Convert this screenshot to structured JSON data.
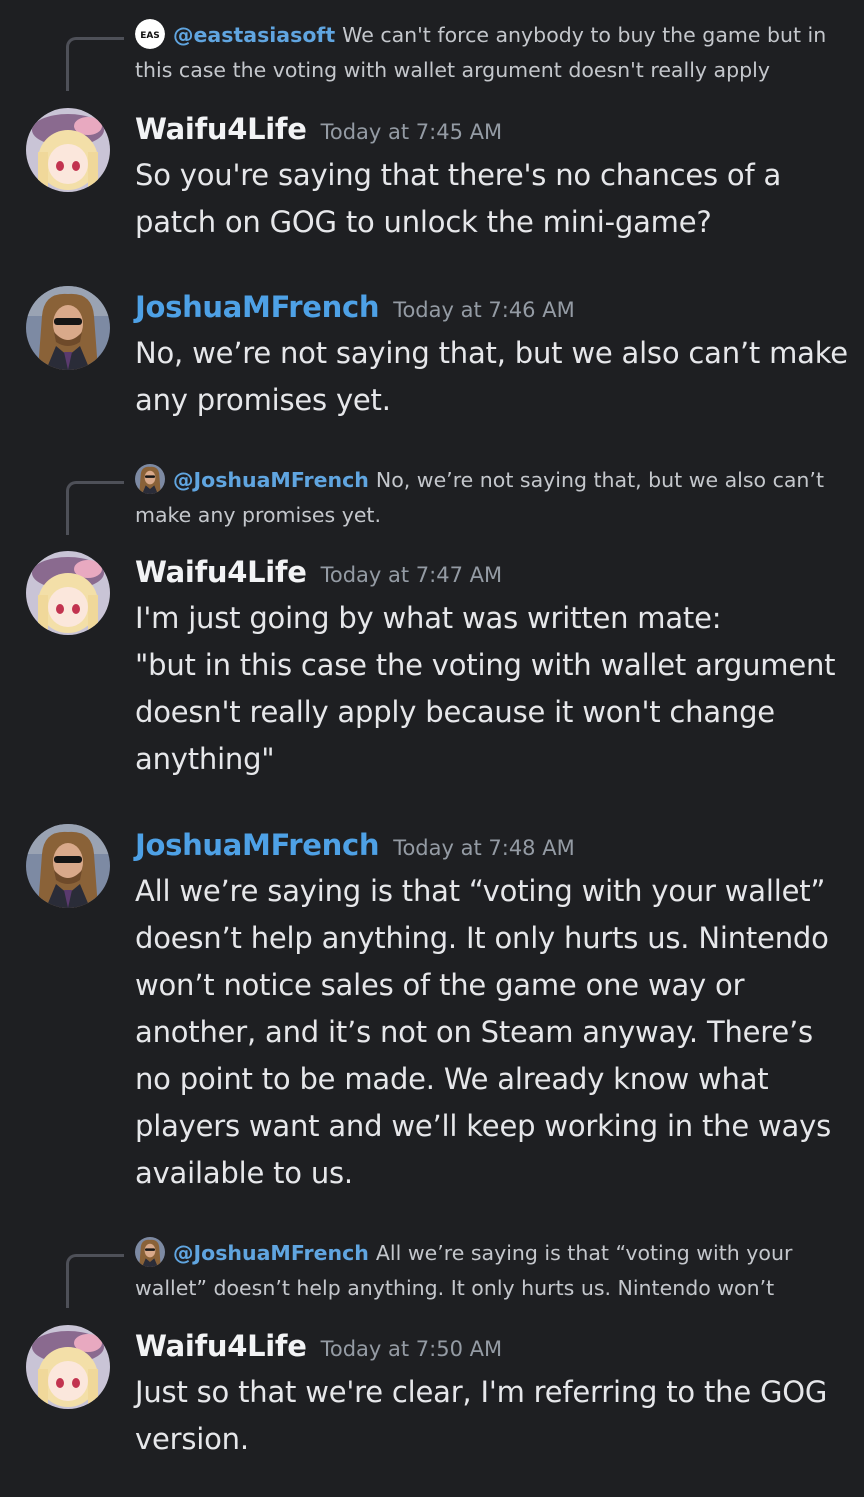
{
  "channel_messages": [
    {
      "reply": {
        "avatar_icon": "eastasiasoft-logo-icon",
        "avatar_text": "EAS",
        "mention": "@eastasiasoft",
        "text": "We can't force anybody to buy the game but in this case the voting with wallet argument doesn't really apply"
      },
      "author": "Waifu4Life",
      "author_color": "#f2f3f5",
      "timestamp": "Today at 7:45 AM",
      "body": "So you're saying that there's no chances of a\npatch on GOG to unlock the mini-game?"
    },
    {
      "author": "JoshuaMFrench",
      "author_color": "#4ea1e6",
      "timestamp": "Today at 7:46 AM",
      "body": "No, we’re not saying that, but we also can’t make\nany promises yet."
    },
    {
      "reply": {
        "avatar_icon": "joshuamfrench-avatar-icon",
        "mention": "@JoshuaMFrench",
        "text": "No, we’re not saying that, but we also can’t make any promises yet."
      },
      "author": "Waifu4Life",
      "author_color": "#f2f3f5",
      "timestamp": "Today at 7:47 AM",
      "body": "I'm just going by what was written mate:\n\"but in this case the voting with wallet argument\ndoesn't really apply because it won't change\nanything\""
    },
    {
      "author": "JoshuaMFrench",
      "author_color": "#4ea1e6",
      "timestamp": "Today at 7:48 AM",
      "body": "All we’re saying is that “voting with your wallet”\ndoesn’t help anything. It only hurts us. Nintendo\nwon’t notice sales of the game one way or\nanother, and it’s not on Steam anyway. There’s\nno point to be made. We already know what\nplayers want and we’ll keep working in the ways\navailable to us."
    },
    {
      "reply": {
        "avatar_icon": "joshuamfrench-avatar-icon",
        "mention": "@JoshuaMFrench",
        "text": "All we’re saying is that “voting with your wallet” doesn’t help anything. It only hurts us. Nintendo won’t"
      },
      "author": "Waifu4Life",
      "author_color": "#f2f3f5",
      "timestamp": "Today at 7:50 AM",
      "body": "Just so that we're clear, I'm referring to the GOG\nversion."
    }
  ],
  "colors": {
    "background": "#1e1f22",
    "mention": "#60a5e0",
    "timestamp": "#949ba4"
  }
}
